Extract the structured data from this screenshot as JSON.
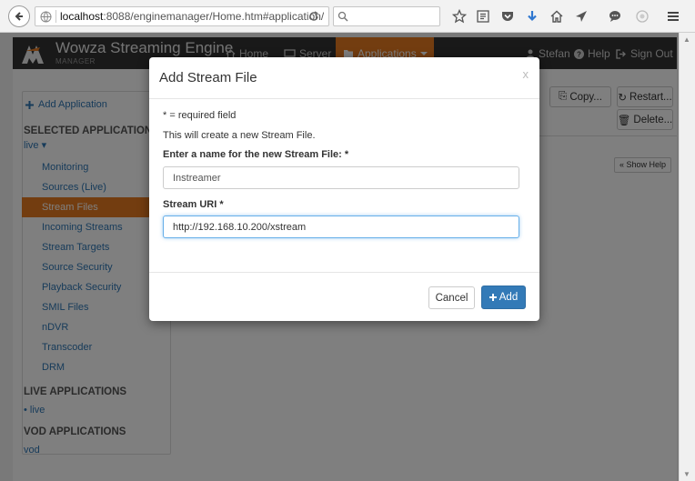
{
  "browser": {
    "url_host": "localhost",
    "url_rest": ":8088/enginemanager/Home.htm#application/",
    "search_placeholder": "",
    "reload_icon": "reload-icon"
  },
  "app": {
    "brand_title": "Wowza Streaming Engine",
    "brand_subtitle": "MANAGER",
    "nav": {
      "home": "Home",
      "server": "Server",
      "applications": "Applications",
      "user": "Stefan",
      "help": "Help",
      "sign_out": "Sign Out"
    },
    "accent_color": "#e67a20"
  },
  "sidebar": {
    "add_application": "Add Application",
    "selected_heading": "SELECTED APPLICATION",
    "selected_app": "live",
    "items": [
      {
        "label": "Monitoring"
      },
      {
        "label": "Sources (Live)"
      },
      {
        "label": "Stream Files"
      },
      {
        "label": "Incoming Streams"
      },
      {
        "label": "Stream Targets"
      },
      {
        "label": "Source Security"
      },
      {
        "label": "Playback Security"
      },
      {
        "label": "SMIL Files"
      },
      {
        "label": "nDVR"
      },
      {
        "label": "Transcoder"
      },
      {
        "label": "DRM"
      }
    ],
    "live_heading": "LIVE APPLICATIONS",
    "live_app": "live",
    "vod_heading": "VOD APPLICATIONS",
    "vod_app": "vod"
  },
  "toolbar": {
    "copy": "Copy...",
    "restart": "Restart...",
    "delete": "Delete...",
    "show_help": "« Show Help"
  },
  "modal": {
    "title": "Add Stream File",
    "close": "x",
    "required_note": "* = required field",
    "description": "This will create a new Stream File.",
    "name_label": "Enter a name for the new Stream File: *",
    "name_value": "Instreamer",
    "uri_label": "Stream URI *",
    "uri_value": "http://192.168.10.200/xstream",
    "cancel": "Cancel",
    "add": "Add",
    "primary_color": "#337ab7"
  }
}
